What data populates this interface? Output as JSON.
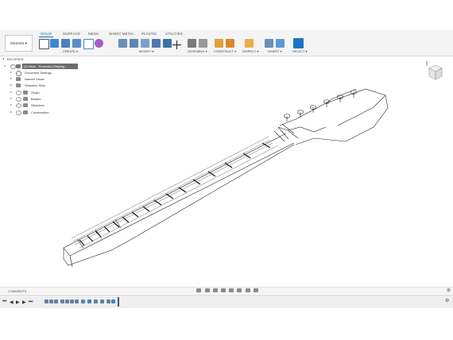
{
  "tabs": [
    "SOLID",
    "SURFACE",
    "MESH",
    "SHEET METAL",
    "PLASTIC",
    "UTILITIES"
  ],
  "workspace_label": "DESIGN ▾",
  "groups": {
    "create": "CREATE ▾",
    "modify": "MODIFY ▾",
    "assemble": "ASSEMBLE ▾",
    "construct": "CONSTRUCT ▾",
    "inspect": "INSPECT ▾",
    "insert": "INSERT ▾",
    "select": "SELECT ▾"
  },
  "browser": {
    "title": "BROWSER",
    "root": "(1) Neck - Rounded (Striping...",
    "items": [
      "Document Settings",
      "Named Views",
      "Selection Sets",
      "Origin",
      "Bodies",
      "Sketches",
      "Construction"
    ]
  },
  "comments_label": "COMMENTS",
  "colors": {
    "accent": "#0a6fc2",
    "toolbar": "#f4f4f4"
  }
}
